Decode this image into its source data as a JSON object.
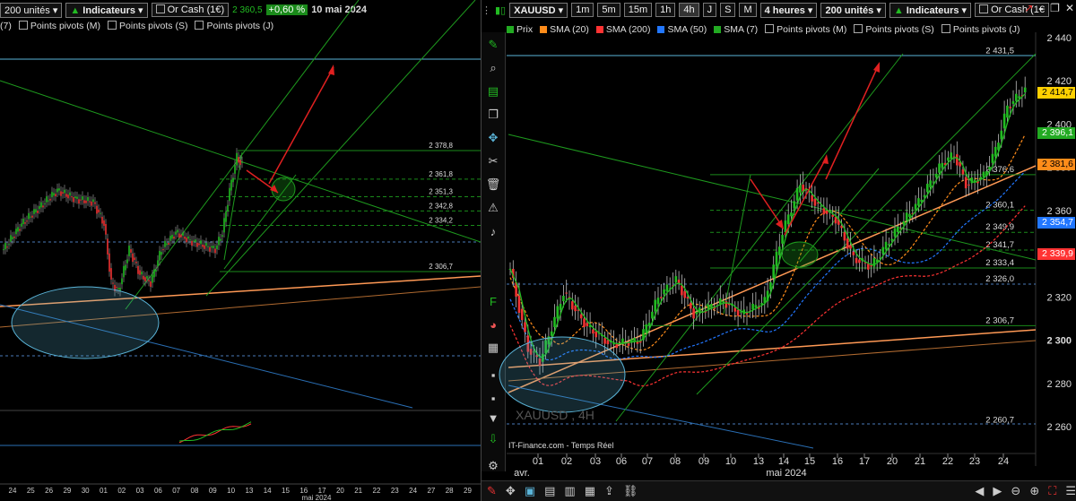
{
  "left": {
    "toolbar": {
      "units": "200 unités",
      "indicators": "Indicateurs",
      "or_cash": "Or Cash (1€)",
      "price": "2 360,5",
      "change": "+0,60 %",
      "date": "10 mai 2024"
    },
    "legend": [
      "(7)",
      "Points pivots (M)",
      "Points pivots (S)",
      "Points pivots (J)"
    ],
    "levels": [
      {
        "label": "2 378,8"
      },
      {
        "label": "2 361,8"
      },
      {
        "label": "2 351,3"
      },
      {
        "label": "2 342,8"
      },
      {
        "label": "2 334,2"
      },
      {
        "label": "2 306,7"
      }
    ],
    "x_ticks": [
      "24",
      "25",
      "26",
      "29",
      "30",
      "01",
      "02",
      "03",
      "06",
      "07",
      "08",
      "09",
      "10",
      "13",
      "14",
      "15",
      "16",
      "17",
      "20",
      "21",
      "22",
      "23",
      "24",
      "27",
      "28",
      "29"
    ],
    "month_label": "mai 2024"
  },
  "right": {
    "toolbar": {
      "symbol": "XAUUSD",
      "timeframes": [
        "1m",
        "5m",
        "15m",
        "1h",
        "4h",
        "J",
        "S",
        "M"
      ],
      "period": "4 heures",
      "units": "200 unités",
      "indicators": "Indicateurs",
      "or_cash": "Or Cash (1€"
    },
    "legend": [
      {
        "label": "Prix",
        "color": "#22aa22"
      },
      {
        "label": "SMA (20)",
        "color": "#ff8c1a"
      },
      {
        "label": "SMA (200)",
        "color": "#ff3333"
      },
      {
        "label": "SMA (50)",
        "color": "#2277ff"
      },
      {
        "label": "SMA (7)",
        "color": "#22aa22"
      },
      {
        "label": "Points pivots (M)",
        "color": ""
      },
      {
        "label": "Points pivots (S)",
        "color": ""
      },
      {
        "label": "Points pivots (J)",
        "color": ""
      }
    ],
    "levels": [
      {
        "label": "2 431,5"
      },
      {
        "label": "2 376,6"
      },
      {
        "label": "2 360,1"
      },
      {
        "label": "2 349,9"
      },
      {
        "label": "2 341,7"
      },
      {
        "label": "2 333,4"
      },
      {
        "label": "2 326,0"
      },
      {
        "label": "2 306,7"
      },
      {
        "label": "2 260,7"
      }
    ],
    "price_axis": [
      "2 440",
      "2 420",
      "2 400",
      "2 380",
      "2 360",
      "2 340",
      "2 320",
      "2 300",
      "2 280",
      "2 260"
    ],
    "tags": [
      {
        "label": "2 414,7",
        "color": "#ffd000"
      },
      {
        "label": "2 396,1",
        "color": "#22aa22"
      },
      {
        "label": "2 381,6",
        "color": "#ff8c1a"
      },
      {
        "label": "2 354,7",
        "color": "#2277ff"
      },
      {
        "label": "2 339,9",
        "color": "#ff3333"
      }
    ],
    "x_ticks": [
      "01",
      "02",
      "03",
      "06",
      "07",
      "08",
      "09",
      "10",
      "13",
      "14",
      "15",
      "16",
      "17",
      "20",
      "21",
      "22",
      "23",
      "24"
    ],
    "month_labels": [
      "avr.",
      "mai 2024"
    ],
    "watermark": "XAUUSD , 4H",
    "source": "IT-Finance.com - Temps Réel",
    "colors": {
      "up": "#22bb22",
      "down": "#ee3333",
      "pivot": "#1a8a1a",
      "sma20": "#ff8c1a",
      "sma50": "#2277ff",
      "sma200": "#ff3333",
      "trend": "#ff9955",
      "cyan": "#5ab4d8"
    }
  }
}
